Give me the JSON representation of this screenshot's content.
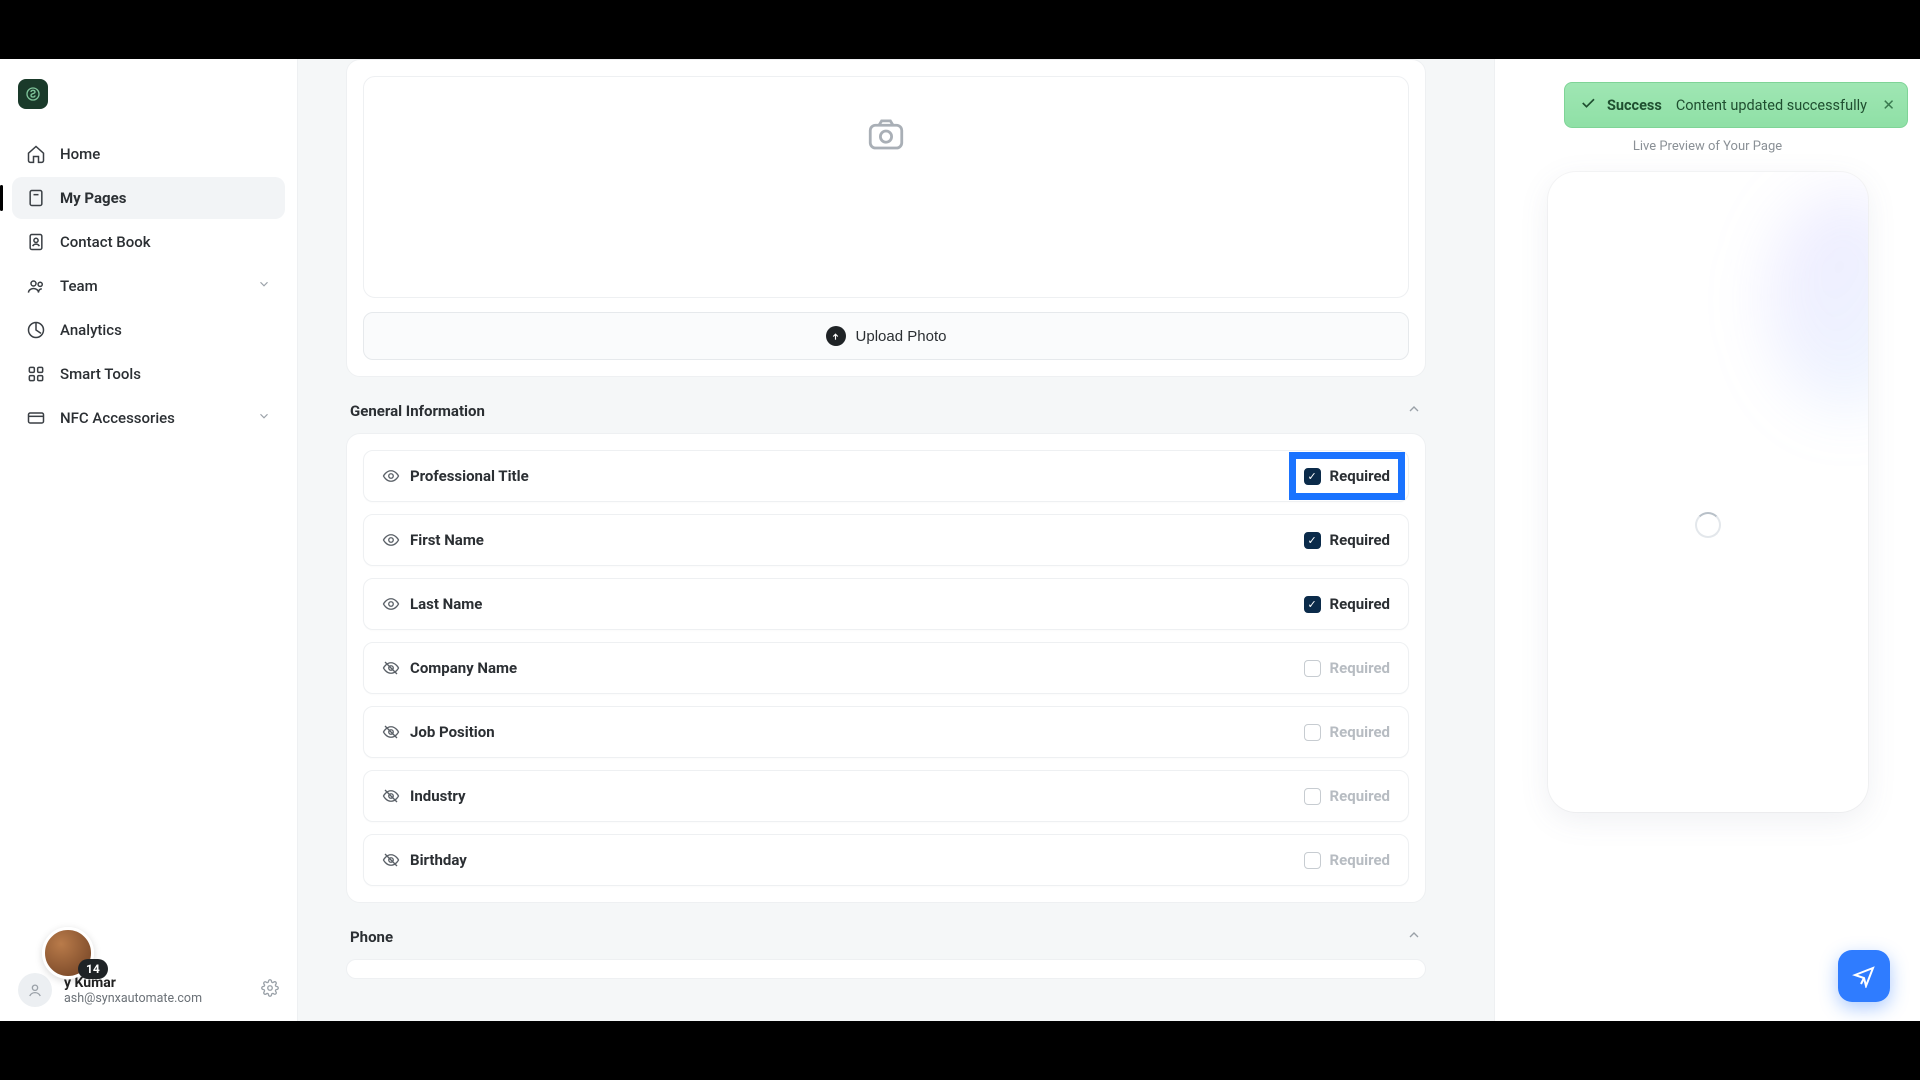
{
  "sidebar": {
    "items": [
      {
        "label": "Home"
      },
      {
        "label": "My Pages"
      },
      {
        "label": "Contact Book"
      },
      {
        "label": "Team"
      },
      {
        "label": "Analytics"
      },
      {
        "label": "Smart Tools"
      },
      {
        "label": "NFC Accessories"
      }
    ],
    "user": {
      "name_suffix": "y Kumar",
      "email": "ash@synxautomate.com",
      "badge": "14"
    }
  },
  "upload": {
    "button": "Upload Photo"
  },
  "sections": {
    "general": {
      "title": "General Information",
      "required_label": "Required",
      "fields": [
        {
          "label": "Professional Title",
          "visible": true,
          "required": true
        },
        {
          "label": "First Name",
          "visible": true,
          "required": true
        },
        {
          "label": "Last Name",
          "visible": true,
          "required": true
        },
        {
          "label": "Company Name",
          "visible": false,
          "required": false
        },
        {
          "label": "Job Position",
          "visible": false,
          "required": false
        },
        {
          "label": "Industry",
          "visible": false,
          "required": false
        },
        {
          "label": "Birthday",
          "visible": false,
          "required": false
        }
      ]
    },
    "phone": {
      "title": "Phone"
    }
  },
  "preview": {
    "caption": "Live Preview of Your Page"
  },
  "toast": {
    "title": "Success",
    "message": "Content updated successfully"
  }
}
